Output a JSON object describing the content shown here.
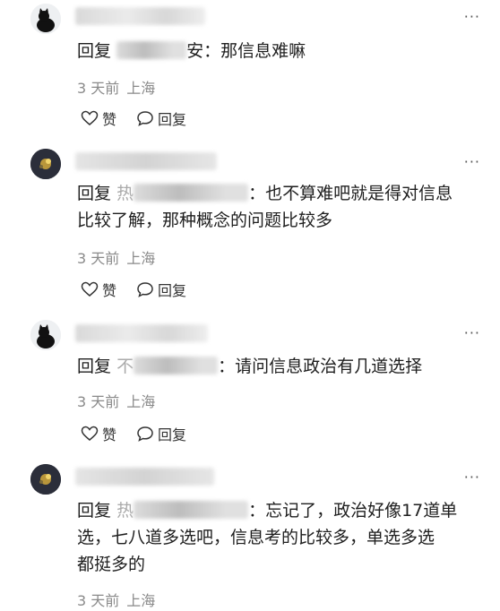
{
  "comments": [
    {
      "reply_prefix": "回复",
      "reply_tail": "安",
      "text": "：那信息难嘛",
      "time": "3 天前",
      "location": "上海",
      "like_label": "赞",
      "reply_label": "回复"
    },
    {
      "reply_prefix": "回复",
      "reply_tail": "热",
      "text_line1": "：也不算难吧就是得对信息",
      "text_line2": "比较了解，那种概念的问题比较多",
      "time": "3 天前",
      "location": "上海",
      "like_label": "赞",
      "reply_label": "回复"
    },
    {
      "reply_prefix": "回复",
      "reply_tail": "不",
      "text": "：请问信息政治有几道选择",
      "time": "3 天前",
      "location": "上海",
      "like_label": "赞",
      "reply_label": "回复"
    },
    {
      "reply_prefix": "回复",
      "reply_tail": "热",
      "text_line1": "：忘记了，政治好像17道单",
      "text_line2": "选，七八道多选吧，信息考的比较多，单选多选",
      "text_line3": "都挺多的",
      "time": "3 天前",
      "location": "上海"
    }
  ],
  "more_label": "···"
}
